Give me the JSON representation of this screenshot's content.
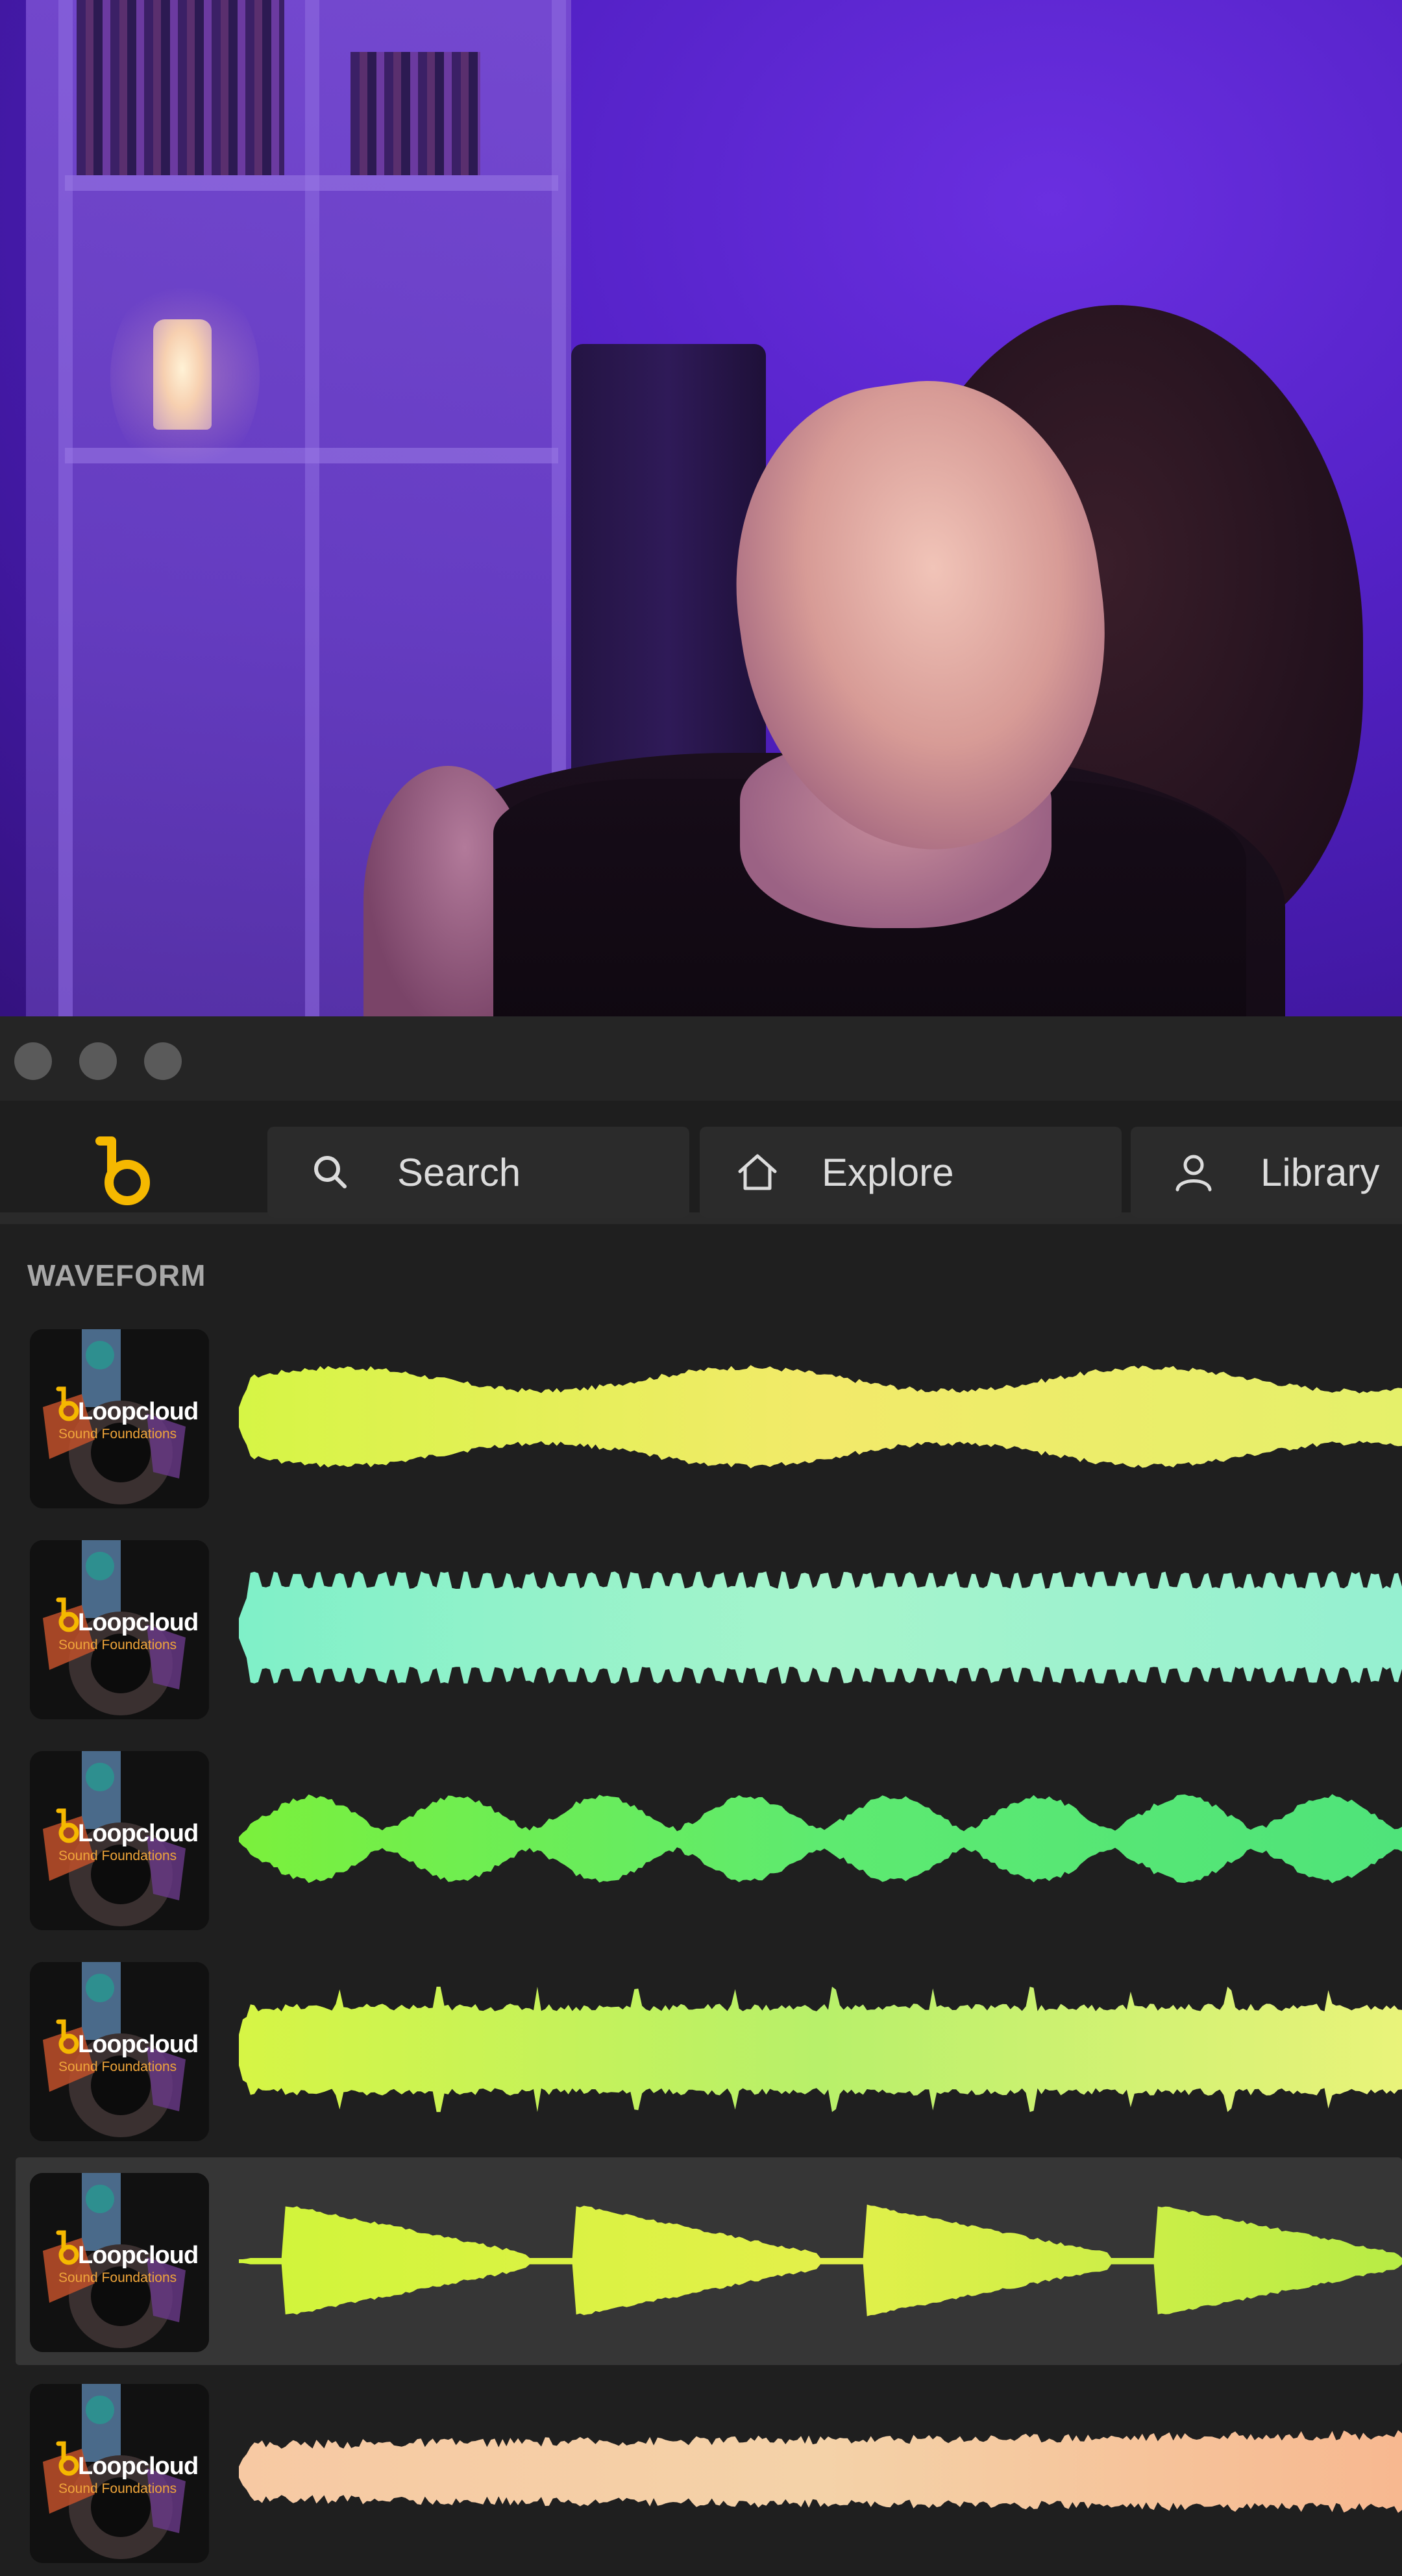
{
  "nav": {
    "search_label": "Search",
    "explore_label": "Explore",
    "library_label": "Library"
  },
  "section": {
    "title": "WAVEFORM"
  },
  "samples": [
    {
      "brand": "Loopcloud",
      "pack": "Sound Foundations",
      "wave_colors": [
        "#d6f545",
        "#f2ea6a",
        "#e5f06a"
      ],
      "shape": "smooth"
    },
    {
      "brand": "Loopcloud",
      "pack": "Sound Foundations",
      "wave_colors": [
        "#7ff0c8",
        "#a6f4cc",
        "#95f0d0"
      ],
      "shape": "spiky"
    },
    {
      "brand": "Loopcloud",
      "pack": "Sound Foundations",
      "wave_colors": [
        "#7bf03c",
        "#5eea70",
        "#4fe37a"
      ],
      "shape": "pulses"
    },
    {
      "brand": "Loopcloud",
      "pack": "Sound Foundations",
      "wave_colors": [
        "#d6f545",
        "#b8f06a",
        "#e9f37a"
      ],
      "shape": "dense"
    },
    {
      "brand": "Loopcloud",
      "pack": "Sound Foundations",
      "wave_colors": [
        "#d0f53a",
        "#e3f04a",
        "#b8ec45"
      ],
      "shape": "swells"
    },
    {
      "brand": "Loopcloud",
      "pack": "Sound Foundations",
      "wave_colors": [
        "#f7c9a3",
        "#f4d2a8",
        "#f7b890"
      ],
      "shape": "ramp"
    }
  ],
  "colors": {
    "accent": "#f5b800",
    "window_bg": "#1f1f1f",
    "row_selected": "#363636"
  },
  "selected_index": 4
}
